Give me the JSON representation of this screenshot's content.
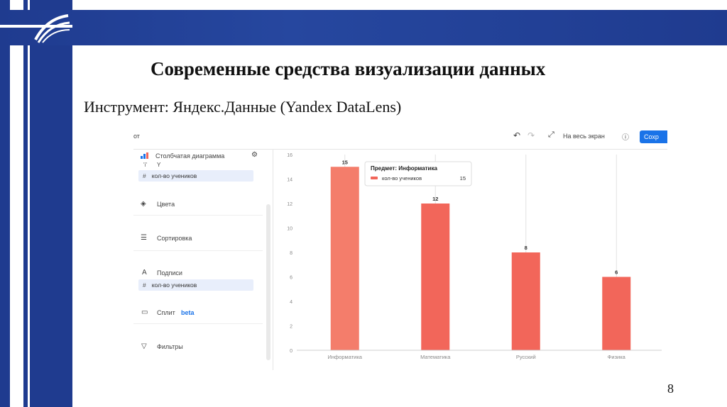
{
  "slide": {
    "title": "Современные средства визуализации данных",
    "subtitle": "Инструмент: Яндекс.Данные (Yandex DataLens)",
    "page_number": "8"
  },
  "toolbar": {
    "left_text": "от",
    "undo_icon": "undo-icon",
    "redo_icon": "redo-icon",
    "fullscreen_label": "На весь экран",
    "info_icon": "info-icon",
    "save_label": "Сохр"
  },
  "panel": {
    "chart_type_label": "Столбчатая диаграмма",
    "y_axis_label": "Y",
    "y_field": "кол-во учеников",
    "colors_label": "Цвета",
    "sort_label": "Сортировка",
    "labels_label": "Подписи",
    "labels_field": "кол-во учеников",
    "split_label": "Сплит",
    "split_badge": "beta",
    "filters_label": "Фильтры",
    "hash": "#"
  },
  "tooltip": {
    "title": "Предмет: Информатика",
    "series": "кол-во учеников",
    "value": "15"
  },
  "colors": {
    "bar_highlight": "#f47d6b",
    "bar": "#f2665a",
    "accent": "#1a73e8",
    "frame": "#1f3b8f"
  },
  "chart_data": {
    "type": "bar",
    "categories": [
      "Информатика",
      "Математика",
      "Русский",
      "Физика"
    ],
    "values": [
      15,
      12,
      8,
      6
    ],
    "ylim": [
      0,
      16
    ],
    "yticks": [
      0,
      2,
      4,
      6,
      8,
      10,
      12,
      14,
      16
    ],
    "data_labels": true,
    "grid": false
  }
}
